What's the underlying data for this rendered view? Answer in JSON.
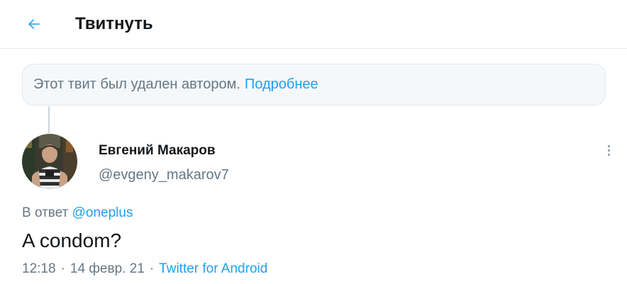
{
  "header": {
    "title": "Твитнуть",
    "back_icon": "arrow-left-icon",
    "accent_color": "#1da1f2"
  },
  "deleted_notice": {
    "text": "Этот твит был удален автором.",
    "link_label": "Подробнее"
  },
  "tweet": {
    "author": {
      "display_name": "Евгений Макаров",
      "handle": "@evgeny_makarov7",
      "avatar_icon": "user-photo-avatar"
    },
    "more_icon": "more-vertical-icon",
    "reply_prefix": "В ответ",
    "reply_mention": "@oneplus",
    "text": "A condom?",
    "time": "12:18",
    "date": "14 февр. 21",
    "separator": "·",
    "source": "Twitter for Android"
  }
}
